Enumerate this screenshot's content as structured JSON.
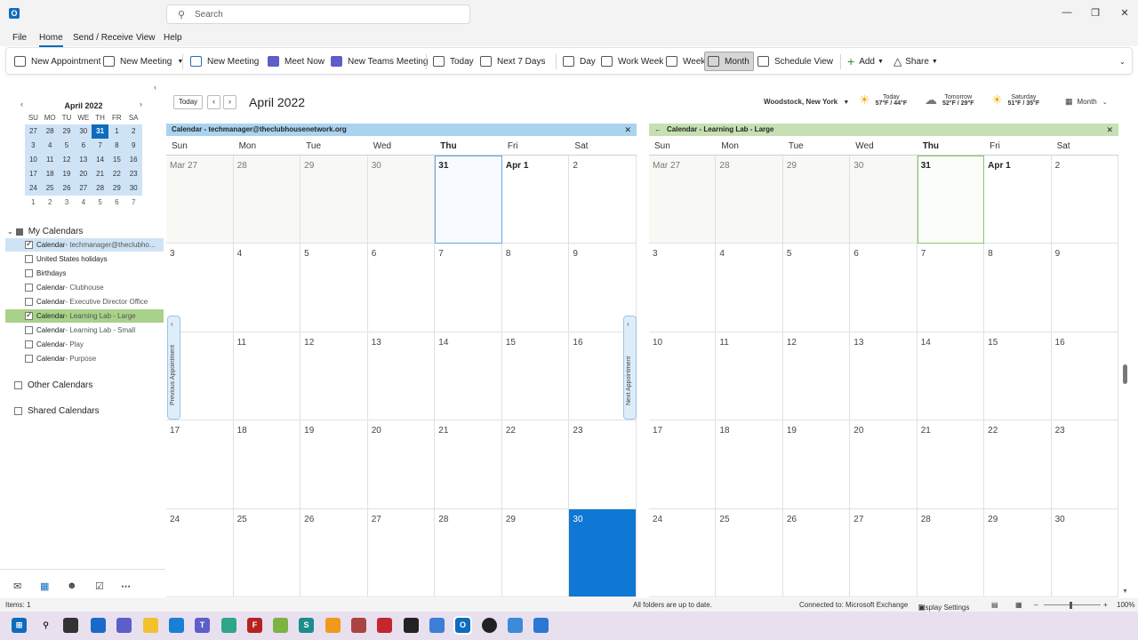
{
  "window": {
    "search_placeholder": "Search"
  },
  "menu": [
    "File",
    "Home",
    "Send / Receive",
    "View",
    "Help"
  ],
  "ribbon": {
    "new_appointment": "New Appointment",
    "new_meeting_dd": "New Meeting",
    "new_meeting": "New Meeting",
    "meet_now": "Meet Now",
    "new_teams_meeting": "New Teams Meeting",
    "today": "Today",
    "next7": "Next 7 Days",
    "day": "Day",
    "work_week": "Work Week",
    "week": "Week",
    "month": "Month",
    "schedule_view": "Schedule View",
    "add": "Add",
    "share": "Share"
  },
  "mini_calendar": {
    "title": "April 2022",
    "weekdays": [
      "SU",
      "MO",
      "TU",
      "WE",
      "TH",
      "FR",
      "SA"
    ],
    "weeks": [
      [
        "27",
        "28",
        "29",
        "30",
        "31",
        "1",
        "2"
      ],
      [
        "3",
        "4",
        "5",
        "6",
        "7",
        "8",
        "9"
      ],
      [
        "10",
        "11",
        "12",
        "13",
        "14",
        "15",
        "16"
      ],
      [
        "17",
        "18",
        "19",
        "20",
        "21",
        "22",
        "23"
      ],
      [
        "24",
        "25",
        "26",
        "27",
        "28",
        "29",
        "30"
      ],
      [
        "1",
        "2",
        "3",
        "4",
        "5",
        "6",
        "7"
      ]
    ]
  },
  "sidebar": {
    "my_calendars": "My Calendars",
    "items": [
      {
        "name": "Calendar",
        "sub": " - techmanager@theclubho...",
        "checked": true
      },
      {
        "name": "United States holidays",
        "sub": "",
        "checked": false
      },
      {
        "name": "Birthdays",
        "sub": "",
        "checked": false
      },
      {
        "name": "Calendar",
        "sub": " - Clubhouse",
        "checked": false
      },
      {
        "name": "Calendar",
        "sub": " - Executive Director Office",
        "checked": false
      },
      {
        "name": "Calendar",
        "sub": " - Learning Lab - Large",
        "checked": true
      },
      {
        "name": "Calendar",
        "sub": " - Learning Lab - Small",
        "checked": false
      },
      {
        "name": "Calendar",
        "sub": " - Play",
        "checked": false
      },
      {
        "name": "Calendar",
        "sub": " - Purpose",
        "checked": false
      }
    ],
    "other_calendars": "Other Calendars",
    "shared_calendars": "Shared Calendars"
  },
  "header": {
    "today": "Today",
    "title": "April 2022",
    "location": "Woodstock, New York",
    "weather": [
      {
        "label": "Today",
        "temps": "57°F / 44°F"
      },
      {
        "label": "Tomorrow",
        "temps": "52°F / 29°F"
      },
      {
        "label": "Saturday",
        "temps": "51°F / 35°F"
      }
    ],
    "view": "Month"
  },
  "calendar_left": {
    "title": "Calendar - techmanager@theclubhousenetwork.org",
    "color": "#a9d3ee",
    "prev_appointment": "Previous Appointment",
    "next_appointment": "Next Appointment"
  },
  "calendar_right": {
    "title": "Calendar - Learning Lab - Large",
    "color": "#c6e0b4"
  },
  "day_names": [
    "Sun",
    "Mon",
    "Tue",
    "Wed",
    "Thu",
    "Fri",
    "Sat"
  ],
  "weeks": [
    [
      "Mar 27",
      "28",
      "29",
      "30",
      "31",
      "Apr 1",
      "2"
    ],
    [
      "3",
      "4",
      "5",
      "6",
      "7",
      "8",
      "9"
    ],
    [
      "10",
      "11",
      "12",
      "13",
      "14",
      "15",
      "16"
    ],
    [
      "17",
      "18",
      "19",
      "20",
      "21",
      "22",
      "23"
    ],
    [
      "24",
      "25",
      "26",
      "27",
      "28",
      "29",
      "30"
    ]
  ],
  "status": {
    "items": "Items: 1",
    "uptodate": "All folders are up to date.",
    "connected": "Connected to: Microsoft Exchange",
    "display_settings": "Display Settings",
    "zoom": "100%"
  }
}
